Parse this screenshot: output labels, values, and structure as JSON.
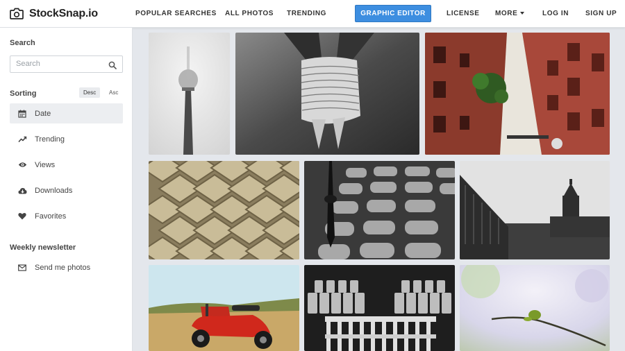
{
  "brand": {
    "name": "StockSnap.io",
    "icon": "camera-icon"
  },
  "nav": {
    "items": [
      "POPULAR SEARCHES",
      "ALL PHOTOS",
      "TRENDING"
    ],
    "cta": "GRAPHIC EDITOR",
    "license": "LICENSE",
    "more": "MORE",
    "login": "LOG IN",
    "signup": "SIGN UP"
  },
  "sidebar": {
    "search_heading": "Search",
    "search_placeholder": "Search",
    "sorting_heading": "Sorting",
    "sort_desc": "Desc",
    "sort_asc": "Asc",
    "sort_items": [
      {
        "label": "Date",
        "icon": "calendar-icon",
        "active": true
      },
      {
        "label": "Trending",
        "icon": "trend-line-icon",
        "active": false
      },
      {
        "label": "Views",
        "icon": "eye-icon",
        "active": false
      },
      {
        "label": "Downloads",
        "icon": "cloud-download-icon",
        "active": false
      },
      {
        "label": "Favorites",
        "icon": "heart-icon",
        "active": false
      }
    ],
    "newsletter_heading": "Weekly newsletter",
    "newsletter_item": {
      "label": "Send me photos",
      "icon": "envelope-icon"
    }
  },
  "colors": {
    "accent": "#3d8ee0",
    "background": "#e4e7ec",
    "sidebar_bg": "#ffffff",
    "active_item_bg": "#eceef1"
  }
}
